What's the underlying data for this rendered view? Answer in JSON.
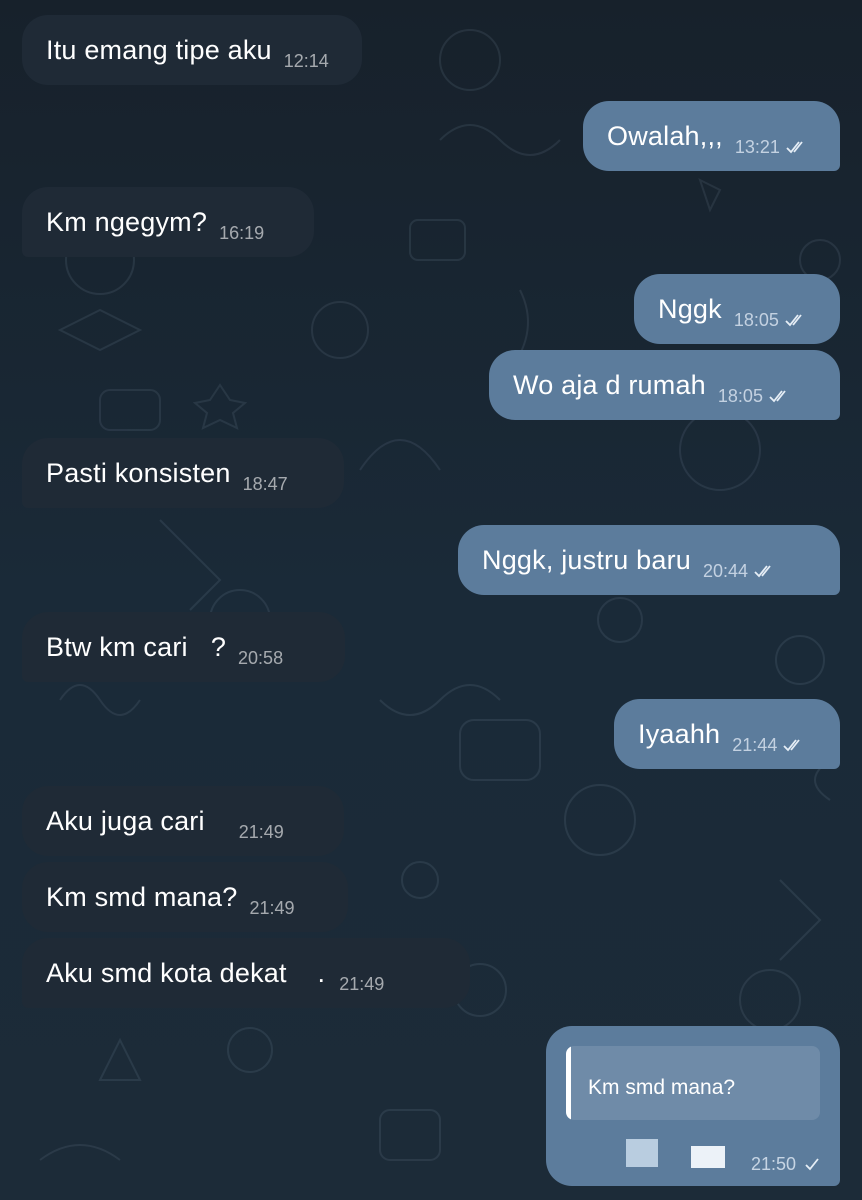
{
  "theme": {
    "background": "#17212b",
    "incoming_bubble": "#1f2a36",
    "outgoing_bubble": "#5c7c9c",
    "text": "#ffffff"
  },
  "messages": [
    {
      "direction": "in",
      "text": "Itu emang tipe aku",
      "time": "12:14",
      "read": false
    },
    {
      "direction": "out",
      "text": "Owalah,,,",
      "time": "13:21",
      "read": true
    },
    {
      "direction": "in",
      "text": "Km ngegym?",
      "time": "16:19",
      "read": false
    },
    {
      "direction": "out",
      "text": "Nggk",
      "time": "18:05",
      "read": true
    },
    {
      "direction": "out",
      "text": "Wo aja d rumah",
      "time": "18:05",
      "read": true
    },
    {
      "direction": "in",
      "text": "Pasti konsisten",
      "time": "18:47",
      "read": false
    },
    {
      "direction": "out",
      "text": "Nggk, justru baru",
      "time": "20:44",
      "read": true
    },
    {
      "direction": "in",
      "text": "Btw km cari   ?",
      "time": "20:58",
      "read": false
    },
    {
      "direction": "out",
      "text": "Iyaahh",
      "time": "21:44",
      "read": true
    },
    {
      "direction": "in",
      "text": "Aku juga cari",
      "time": "21:49",
      "read": false
    },
    {
      "direction": "in",
      "text": "Km smd mana?",
      "time": "21:49",
      "read": false
    },
    {
      "direction": "in",
      "text": "Aku smd kota dekat    .",
      "time": "21:49",
      "read": false
    }
  ],
  "reply_message": {
    "quoted_text": "Km smd mana?",
    "time": "21:50",
    "status": "sent",
    "attachment_icons": [
      "book-icon",
      "rectangle-icon"
    ]
  }
}
